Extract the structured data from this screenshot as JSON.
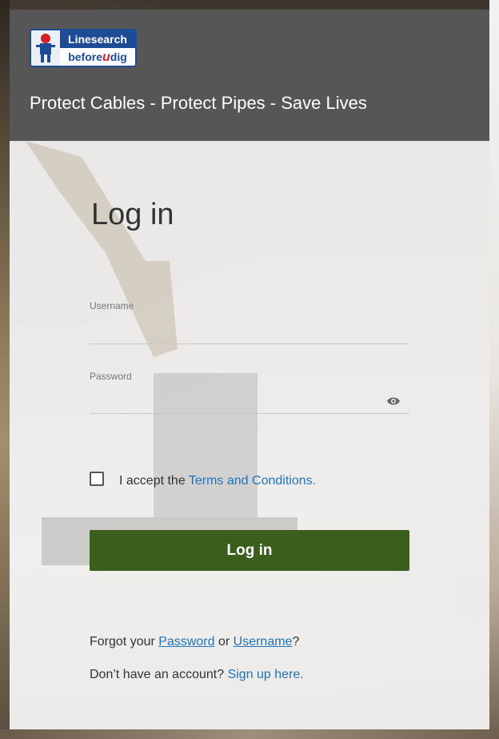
{
  "logo": {
    "line1": "Linesearch",
    "line2_before": "before",
    "line2_u": "u",
    "line2_after": "dig"
  },
  "header": {
    "tagline": "Protect Cables - Protect Pipes - Save Lives"
  },
  "login": {
    "title": "Log in",
    "username": {
      "label": "Username",
      "value": ""
    },
    "password": {
      "label": "Password",
      "value": ""
    },
    "accept": {
      "prefix": "I accept the ",
      "link": "Terms and Conditions.",
      "checked": false
    },
    "button_label": "Log in",
    "forgot": {
      "prefix": "Forgot your ",
      "password_link": "Password",
      "middle": " or ",
      "username_link": "Username",
      "suffix": "?"
    },
    "signup": {
      "prefix": "Don’t have an account? ",
      "link": "Sign up here."
    }
  },
  "colors": {
    "header_bg": "#565656",
    "button_bg": "#3b5e1c",
    "link": "#1f73b7",
    "logo_blue": "#1d4b96",
    "logo_red": "#d42127"
  },
  "icons": {
    "password_toggle": "eye-icon"
  }
}
